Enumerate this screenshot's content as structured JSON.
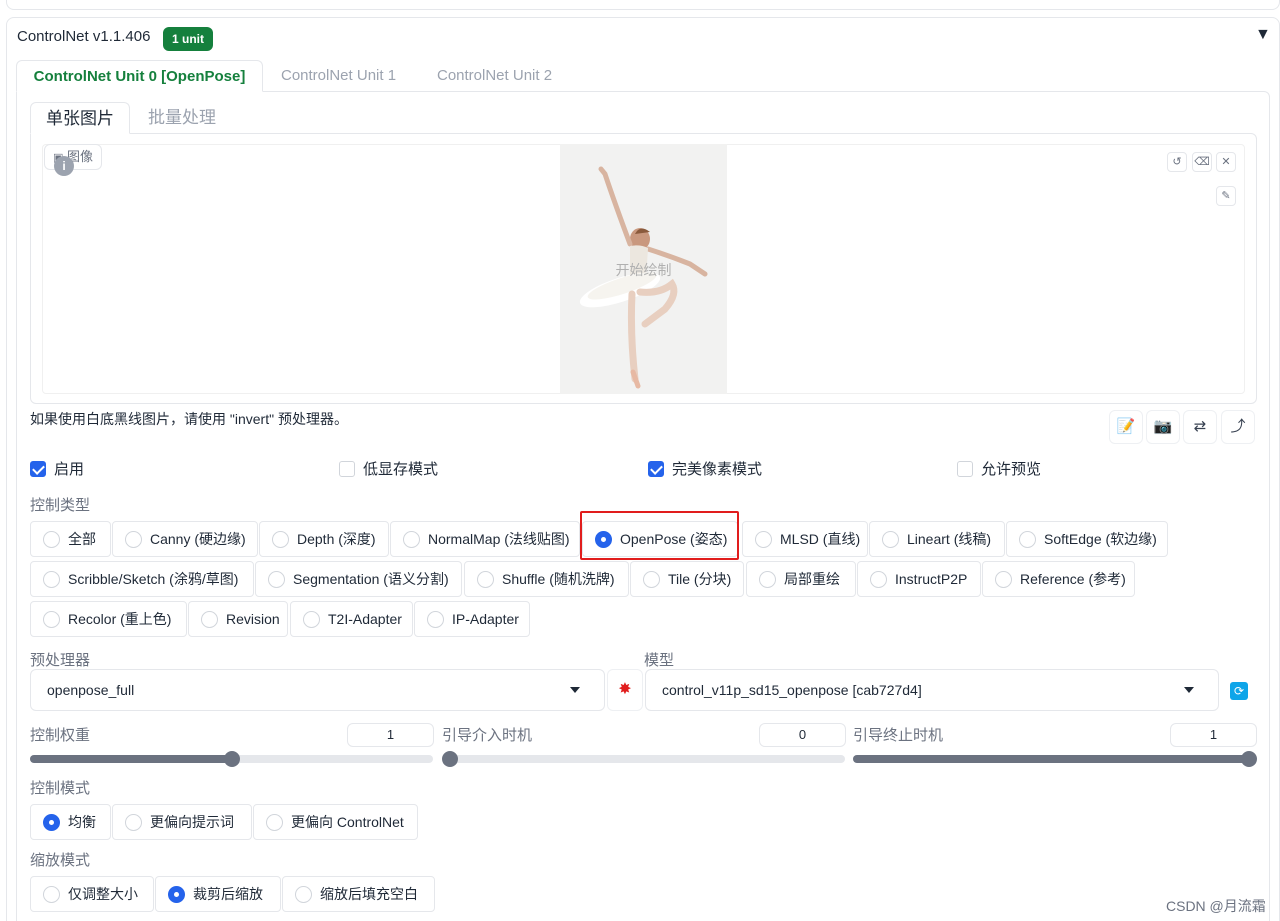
{
  "header": {
    "title": "ControlNet v1.1.406",
    "badge": "1 unit"
  },
  "unit_tabs": [
    {
      "label": "ControlNet Unit 0 [OpenPose]",
      "active": true
    },
    {
      "label": "ControlNet Unit 1",
      "active": false
    },
    {
      "label": "ControlNet Unit 2",
      "active": false
    }
  ],
  "mode_tabs": [
    {
      "label": "单张图片",
      "active": true
    },
    {
      "label": "批量处理",
      "active": false
    }
  ],
  "image_panel": {
    "label": "图像",
    "placeholder": "开始绘制"
  },
  "hint": "如果使用白底黑线图片，请使用 \"invert\" 预处理器。",
  "checkboxes": [
    {
      "label": "启用",
      "checked": true
    },
    {
      "label": "低显存模式",
      "checked": false
    },
    {
      "label": "完美像素模式",
      "checked": true
    },
    {
      "label": "允许预览",
      "checked": false
    }
  ],
  "control_type": {
    "label": "控制类型",
    "options": [
      "全部",
      "Canny (硬边缘)",
      "Depth (深度)",
      "NormalMap (法线贴图)",
      "OpenPose (姿态)",
      "MLSD (直线)",
      "Lineart (线稿)",
      "SoftEdge (软边缘)",
      "Scribble/Sketch (涂鸦/草图)",
      "Segmentation (语义分割)",
      "Shuffle (随机洗牌)",
      "Tile (分块)",
      "局部重绘",
      "InstructP2P",
      "Reference (参考)",
      "Recolor (重上色)",
      "Revision",
      "T2I-Adapter",
      "IP-Adapter"
    ],
    "selected": "OpenPose (姿态)"
  },
  "preprocessor": {
    "label": "预处理器",
    "value": "openpose_full"
  },
  "model": {
    "label": "模型",
    "value": "control_v11p_sd15_openpose [cab727d4]"
  },
  "sliders": [
    {
      "label": "控制权重",
      "value": "1",
      "fraction": 0.5
    },
    {
      "label": "引导介入时机",
      "value": "0",
      "fraction": 0.0
    },
    {
      "label": "引导终止时机",
      "value": "1",
      "fraction": 1.0
    }
  ],
  "control_mode": {
    "label": "控制模式",
    "options": [
      "均衡",
      "更偏向提示词",
      "更偏向 ControlNet"
    ],
    "selected": "均衡"
  },
  "resize_mode": {
    "label": "缩放模式",
    "options": [
      "仅调整大小",
      "裁剪后缩放",
      "缩放后填充空白"
    ],
    "selected": "裁剪后缩放"
  },
  "watermark": "CSDN @月流霜",
  "colors": {
    "accent_green": "#15803d",
    "accent_blue": "#2563eb",
    "highlight_red": "#e11d1d"
  }
}
